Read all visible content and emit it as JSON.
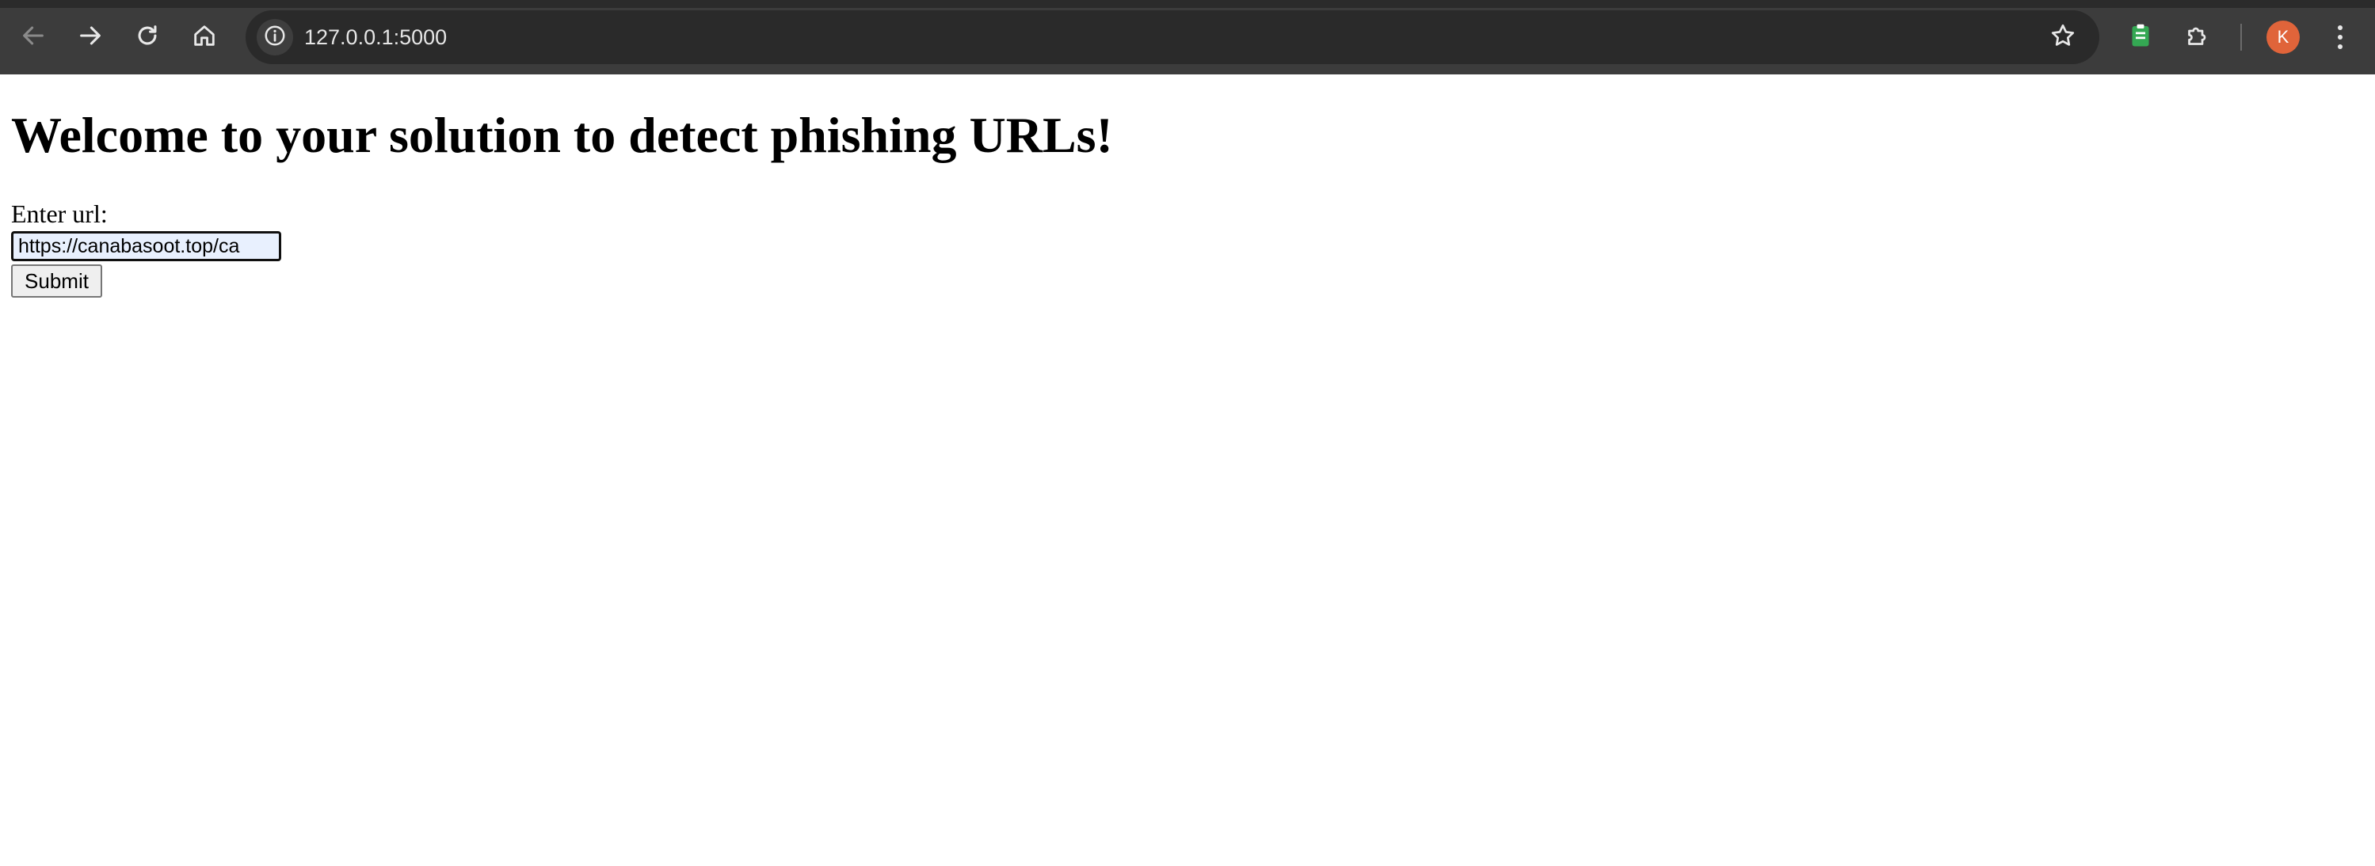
{
  "browser": {
    "address_bar": {
      "url": "127.0.0.1:5000"
    },
    "profile_initial": "K",
    "colors": {
      "toolbar": "#3c3c3c",
      "omnibox": "#2a2a2a",
      "avatar": "#e0643a",
      "extension_green": "#34a853"
    }
  },
  "page": {
    "title": "Welcome to your solution to detect phishing URLs!",
    "form": {
      "label": "Enter url:",
      "input_value": "https://canabasoot.top/ca",
      "submit_label": "Submit"
    }
  }
}
